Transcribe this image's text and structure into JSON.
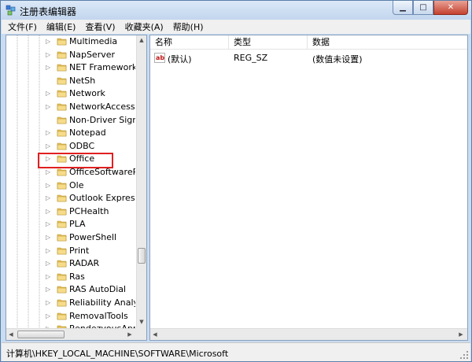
{
  "window": {
    "title": "注册表编辑器",
    "minimize_glyph": "▁",
    "maximize_glyph": "□",
    "close_glyph": "✕"
  },
  "menu": [
    "文件(F)",
    "编辑(E)",
    "查看(V)",
    "收藏夹(A)",
    "帮助(H)"
  ],
  "tree": {
    "selected_highlight": "Office",
    "items": [
      {
        "label": "Multimedia",
        "expandable": true
      },
      {
        "label": "NapServer",
        "expandable": true
      },
      {
        "label": "NET Framework S",
        "expandable": true
      },
      {
        "label": "NetSh",
        "expandable": false
      },
      {
        "label": "Network",
        "expandable": true
      },
      {
        "label": "NetworkAccessPr",
        "expandable": true
      },
      {
        "label": "Non-Driver Signin",
        "expandable": false
      },
      {
        "label": "Notepad",
        "expandable": true
      },
      {
        "label": "ODBC",
        "expandable": true
      },
      {
        "label": "Office",
        "expandable": true
      },
      {
        "label": "OfficeSoftwarePro",
        "expandable": true
      },
      {
        "label": "Ole",
        "expandable": true
      },
      {
        "label": "Outlook Express",
        "expandable": true
      },
      {
        "label": "PCHealth",
        "expandable": true
      },
      {
        "label": "PLA",
        "expandable": true
      },
      {
        "label": "PowerShell",
        "expandable": true
      },
      {
        "label": "Print",
        "expandable": true
      },
      {
        "label": "RADAR",
        "expandable": true
      },
      {
        "label": "Ras",
        "expandable": true
      },
      {
        "label": "RAS AutoDial",
        "expandable": true
      },
      {
        "label": "Reliability Analysis",
        "expandable": true
      },
      {
        "label": "RemovalTools",
        "expandable": true
      },
      {
        "label": "RendezvousApps",
        "expandable": true
      }
    ]
  },
  "list": {
    "columns": [
      "名称",
      "类型",
      "数据"
    ],
    "rows": [
      {
        "icon": "string-value-icon",
        "icon_text": "ab",
        "name": "(默认)",
        "type": "REG_SZ",
        "data": "(数值未设置)"
      }
    ]
  },
  "status": {
    "path": "计算机\\HKEY_LOCAL_MACHINE\\SOFTWARE\\Microsoft"
  },
  "colors": {
    "highlight_border": "#e02020",
    "folder": "#e8c35a"
  },
  "icons": {
    "expand": "▷",
    "scroll_up": "▲",
    "scroll_down": "▼",
    "scroll_left": "◀",
    "scroll_right": "▶"
  }
}
